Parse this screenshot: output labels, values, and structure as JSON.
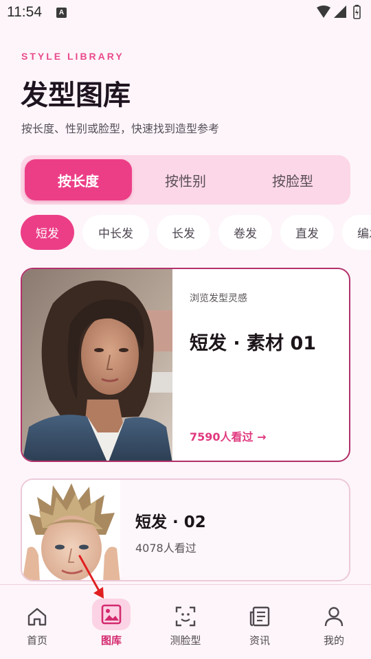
{
  "status_bar": {
    "time": "11:54",
    "notification_badge": "A"
  },
  "header": {
    "kicker": "STYLE LIBRARY",
    "title": "发型图库",
    "subtitle": "按长度、性别或脸型，快速找到造型参考"
  },
  "segments": [
    {
      "label": "按长度",
      "active": true
    },
    {
      "label": "按性别",
      "active": false
    },
    {
      "label": "按脸型",
      "active": false
    }
  ],
  "chips": [
    {
      "label": "短发",
      "active": true
    },
    {
      "label": "中长发",
      "active": false
    },
    {
      "label": "长发",
      "active": false
    },
    {
      "label": "卷发",
      "active": false
    },
    {
      "label": "直发",
      "active": false
    },
    {
      "label": "编发",
      "active": false
    }
  ],
  "feature_card": {
    "eyebrow": "浏览发型灵感",
    "title": "短发 · 素材 01",
    "views": "7590人看过 →"
  },
  "item_card": {
    "title": "短发 · 02",
    "views": "4078人看过"
  },
  "bottom_nav": [
    {
      "label": "首页",
      "icon": "home-icon",
      "active": false
    },
    {
      "label": "图库",
      "icon": "gallery-icon",
      "active": true
    },
    {
      "label": "测脸型",
      "icon": "face-scan-icon",
      "active": false
    },
    {
      "label": "资讯",
      "icon": "news-icon",
      "active": false
    },
    {
      "label": "我的",
      "icon": "profile-icon",
      "active": false
    }
  ],
  "colors": {
    "accent": "#ec3e87",
    "accent_dark": "#b2306a",
    "background": "#fdf5f9",
    "segment_bg": "#fcd7e7"
  }
}
